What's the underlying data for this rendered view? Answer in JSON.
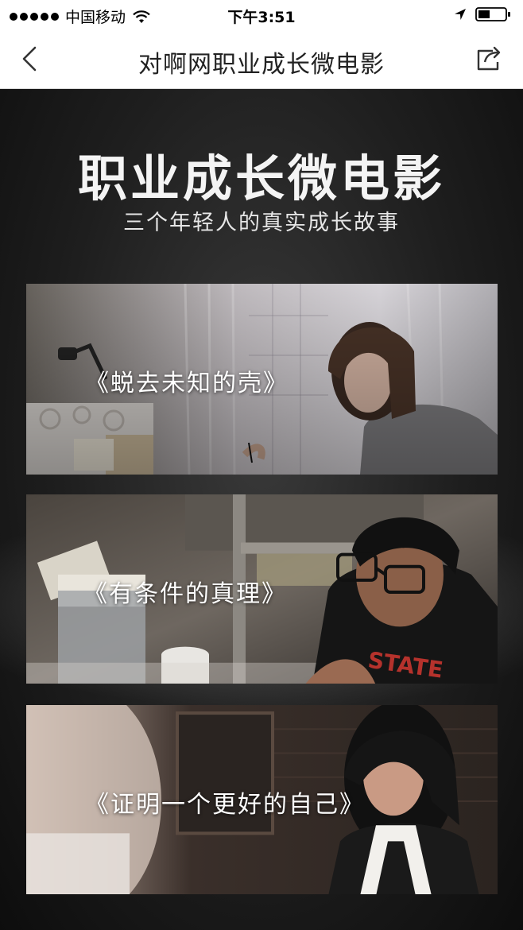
{
  "status_bar": {
    "carrier": "中国移动",
    "time": "下午3:51",
    "icons": [
      "signal-dots",
      "wifi-icon",
      "location-arrow-icon",
      "battery-icon"
    ]
  },
  "nav": {
    "title": "对啊网职业成长微电影",
    "back_icon": "chevron-left-icon",
    "share_icon": "share-icon"
  },
  "hero": {
    "title": "职业成长微电影",
    "subtitle": "三个年轻人的真实成长故事"
  },
  "films": [
    {
      "title": "《蜕去未知的壳》"
    },
    {
      "title": "《有条件的真理》"
    },
    {
      "title": "《证明一个更好的自己》"
    }
  ],
  "colors": {
    "background_dark": "#1a1a1a",
    "header_bg": "#ffffff",
    "title_text": "#f4f4f4"
  }
}
